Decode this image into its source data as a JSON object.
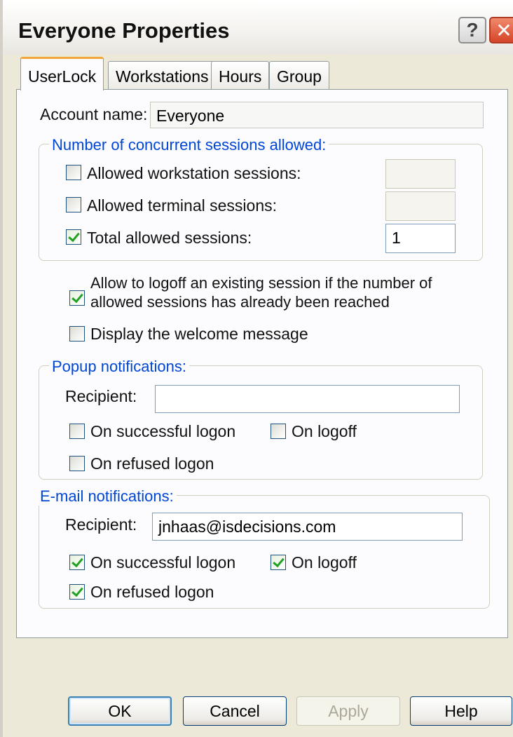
{
  "window": {
    "title": "Everyone Properties",
    "help_glyph": "?",
    "close_glyph": "✕"
  },
  "tabs": [
    {
      "label": "UserLock",
      "active": true
    },
    {
      "label": "Workstations",
      "active": false
    },
    {
      "label": "Hours",
      "active": false
    },
    {
      "label": "Group",
      "active": false
    }
  ],
  "account": {
    "label": "Account name:",
    "value": "Everyone"
  },
  "sessions": {
    "title": "Number of concurrent sessions allowed:",
    "workstation": {
      "label": "Allowed workstation sessions:",
      "checked": false,
      "value": ""
    },
    "terminal": {
      "label": "Allowed terminal sessions:",
      "checked": false,
      "value": ""
    },
    "total": {
      "label": "Total allowed sessions:",
      "checked": true,
      "value": "1"
    }
  },
  "options": {
    "logoff_line1": "Allow to logoff an existing session if the number of",
    "logoff_line2": "allowed sessions has already been reached",
    "logoff_checked": true,
    "welcome": "Display the welcome message",
    "welcome_checked": false
  },
  "popup": {
    "title": "Popup notifications:",
    "recipient_label": "Recipient:",
    "recipient_value": "",
    "successful": {
      "label": "On successful logon",
      "checked": false
    },
    "logoff": {
      "label": "On logoff",
      "checked": false
    },
    "refused": {
      "label": "On refused logon",
      "checked": false
    }
  },
  "email": {
    "title": "E-mail notifications:",
    "recipient_label": "Recipient:",
    "recipient_value": "jnhaas@isdecisions.com",
    "successful": {
      "label": "On successful logon",
      "checked": true
    },
    "logoff": {
      "label": "On logoff",
      "checked": true
    },
    "refused": {
      "label": "On refused logon",
      "checked": true
    }
  },
  "buttons": {
    "ok": "OK",
    "cancel": "Cancel",
    "apply": "Apply",
    "help": "Help"
  },
  "colors": {
    "group_title": "#0046d5",
    "tab_accent": "#f4a63c",
    "check": "#21a121"
  }
}
